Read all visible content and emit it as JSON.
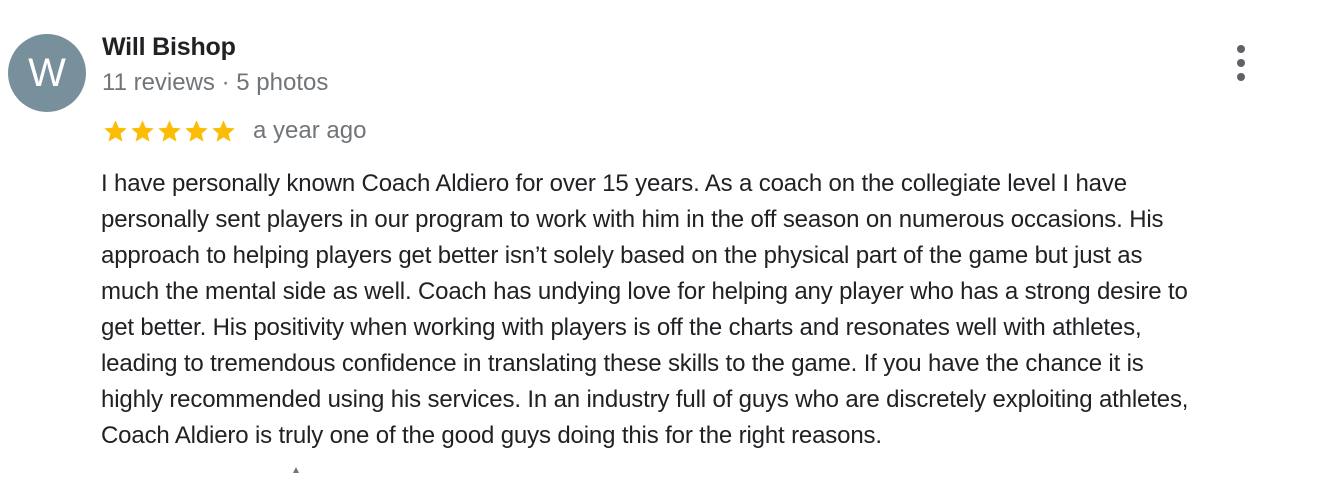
{
  "reviewer": {
    "initial": "W",
    "name": "Will Bishop",
    "meta": "11 reviews · 5 photos",
    "avatar_color": "#78909c"
  },
  "rating": {
    "stars": 5,
    "max_stars": 5,
    "star_color": "#fbbc04",
    "date": "a year ago"
  },
  "menu": {
    "icon": "more-vert-icon"
  },
  "review": {
    "lines": [
      "I have personally known Coach Aldiero for over 15 years. As a coach on the collegiate level I have",
      "personally sent players in our program to work with him in the off season on numerous occasions. His",
      "approach to helping players get better isn’t solely based on the physical part of the game but just as",
      "much the mental side as well. Coach has undying love for helping any player who has a strong desire to",
      "get better. His positivity when working with players is off the charts and resonates well with athletes,",
      "leading to tremendous confidence in translating these skills to the game. If you have the chance it is",
      "highly recommended using his services. In an industry full of guys who are discretely exploiting athletes,",
      "Coach Aldiero is truly one of the good guys doing this for the right reasons."
    ]
  }
}
